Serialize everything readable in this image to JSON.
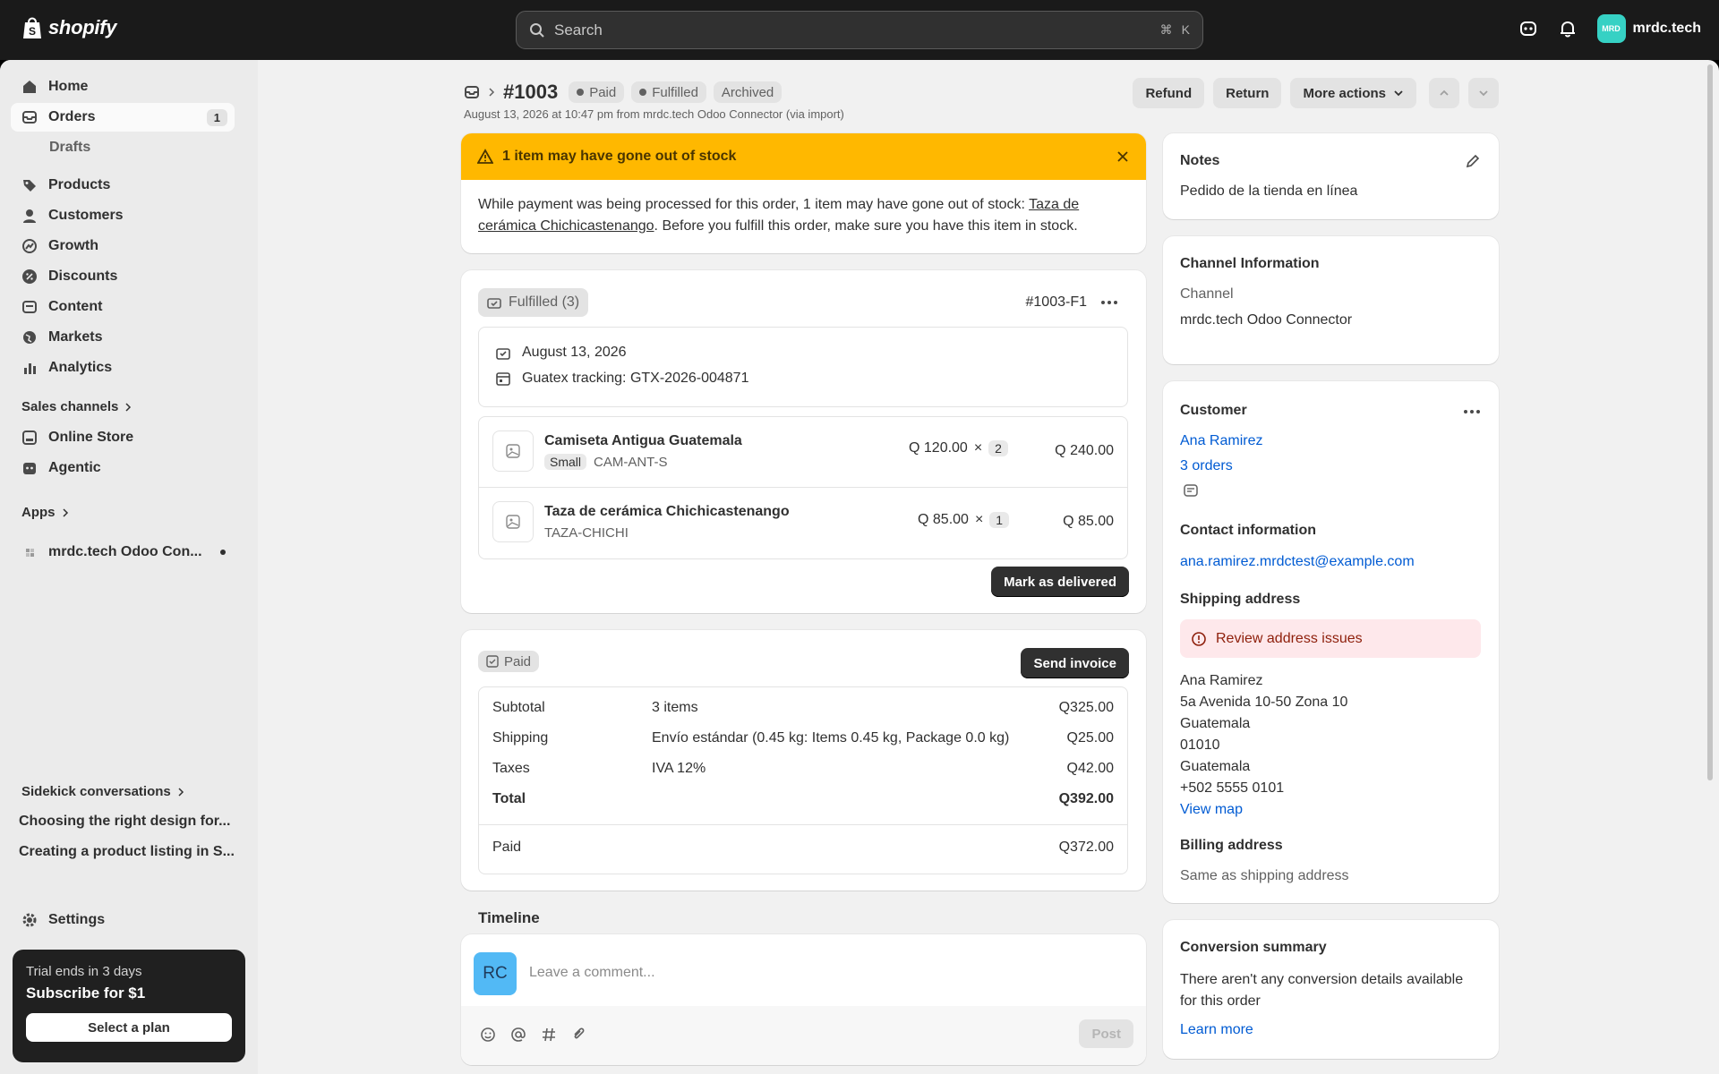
{
  "topbar": {
    "logo_text": "shopify",
    "search_placeholder": "Search",
    "shortcut_cmd": "⌘",
    "shortcut_key": "K",
    "store_avatar": "MRD",
    "store_name": "mrdc.tech"
  },
  "sidebar": {
    "home": "Home",
    "orders": "Orders",
    "orders_badge": "1",
    "drafts": "Drafts",
    "products": "Products",
    "customers": "Customers",
    "growth": "Growth",
    "discounts": "Discounts",
    "content": "Content",
    "markets": "Markets",
    "analytics": "Analytics",
    "sales_channels": "Sales channels",
    "online_store": "Online Store",
    "agentic": "Agentic",
    "apps": "Apps",
    "app_item": "mrdc.tech Odoo Con...",
    "sidekick_label": "Sidekick conversations",
    "sidekick_1": "Choosing the right design for...",
    "sidekick_2": "Creating a product listing in S...",
    "settings": "Settings",
    "trial_line": "Trial ends in 3 days",
    "trial_cta": "Subscribe for $1",
    "trial_button": "Select a plan"
  },
  "header": {
    "order_number": "#1003",
    "badges": [
      "Paid",
      "Fulfilled",
      "Archived"
    ],
    "subtitle": "August 13, 2026 at 10:47 pm from mrdc.tech Odoo Connector (via import)",
    "refund": "Refund",
    "return": "Return",
    "more_actions": "More actions"
  },
  "stock_alert": {
    "title": "1 item may have gone out of stock",
    "body_pre": "While payment was being processed for this order, 1 item may have gone out of stock: ",
    "body_link_1": "Taza de",
    "body_link_2": "cerámica Chichicastenango",
    "body_post": ". Before you fulfill this order, make sure you have this item in stock."
  },
  "fulfillment": {
    "status": "Fulfilled (3)",
    "id": "#1003-F1",
    "date": "August 13, 2026",
    "tracking": "Guatex tracking: GTX-2026-004871",
    "items": [
      {
        "name": "Camiseta Antigua Guatemala",
        "variant": "Small",
        "sku": "CAM-ANT-S",
        "price": "Q 120.00",
        "times": "×",
        "qty": "2",
        "total": "Q 240.00"
      },
      {
        "name": "Taza de cerámica Chichicastenango",
        "variant": "",
        "sku": "TAZA-CHICHI",
        "price": "Q 85.00",
        "times": "×",
        "qty": "1",
        "total": "Q 85.00"
      }
    ],
    "mark_delivered": "Mark as delivered"
  },
  "payment": {
    "status": "Paid",
    "send_invoice": "Send invoice",
    "rows": [
      {
        "label": "Subtotal",
        "desc": "3 items",
        "amount": "Q325.00"
      },
      {
        "label": "Shipping",
        "desc": "Envío estándar (0.45 kg: Items 0.45 kg, Package 0.0 kg)",
        "amount": "Q25.00"
      },
      {
        "label": "Taxes",
        "desc": "IVA 12%",
        "amount": "Q42.00"
      },
      {
        "label": "Total",
        "desc": "",
        "amount": "Q392.00"
      }
    ],
    "paid_label": "Paid",
    "paid_amount": "Q372.00"
  },
  "timeline": {
    "title": "Timeline",
    "avatar": "RC",
    "placeholder": "Leave a comment...",
    "post": "Post"
  },
  "notes": {
    "title": "Notes",
    "text": "Pedido de la tienda en línea"
  },
  "channel": {
    "title": "Channel Information",
    "label": "Channel",
    "value": "mrdc.tech Odoo Connector"
  },
  "customer": {
    "title": "Customer",
    "name": "Ana Ramirez",
    "orders": "3 orders",
    "contact_title": "Contact information",
    "email": "ana.ramirez.mrdctest@example.com",
    "shipping_title": "Shipping address",
    "address_warning": "Review address issues",
    "address_lines": [
      "Ana Ramirez",
      "5a Avenida 10-50 Zona 10",
      "Guatemala",
      "01010",
      "Guatemala",
      "+502 5555 0101"
    ],
    "view_map": "View map",
    "billing_title": "Billing address",
    "billing_text": "Same as shipping address"
  },
  "conversion": {
    "title": "Conversion summary",
    "text_1": "There aren't any conversion details available",
    "text_2": "for this order",
    "learn_more": "Learn more"
  },
  "colors": {
    "alert_bg": "#ffb800",
    "link": "#005bd3",
    "warning_bg": "#fee8eb",
    "avatar_teal": "#36d1c4",
    "avatar_blue": "#52b9f5"
  }
}
